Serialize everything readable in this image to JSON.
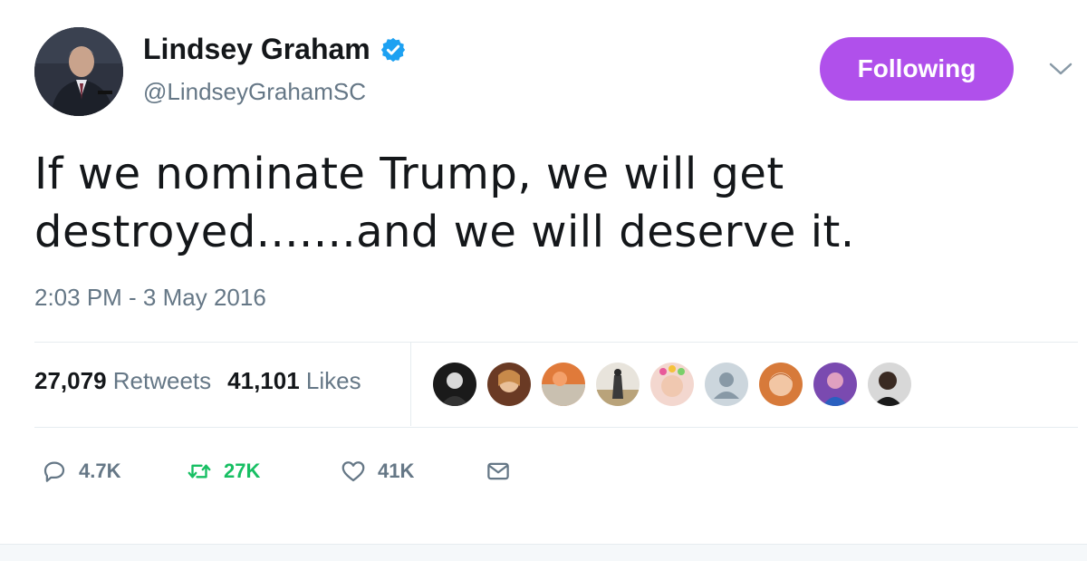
{
  "author": {
    "name": "Lindsey Graham",
    "handle": "@LindseyGrahamSC",
    "avatar_icon": "profile-photo"
  },
  "follow_button": {
    "label": "Following",
    "color": "#b050eb"
  },
  "tweet": {
    "line1": "If we nominate Trump, we will get",
    "line2": "destroyed.......and we will deserve it.",
    "timestamp": "2:03 PM - 3 May 2016"
  },
  "stats": {
    "retweets_count": "27,079",
    "retweets_label": "Retweets",
    "likes_count": "41,101",
    "likes_label": "Likes"
  },
  "actions": {
    "replies": "4.7K",
    "retweets": "27K",
    "likes": "41K"
  },
  "colors": {
    "retweet_green": "#17bf63",
    "verified_blue": "#1da1f2",
    "muted": "#657786"
  }
}
